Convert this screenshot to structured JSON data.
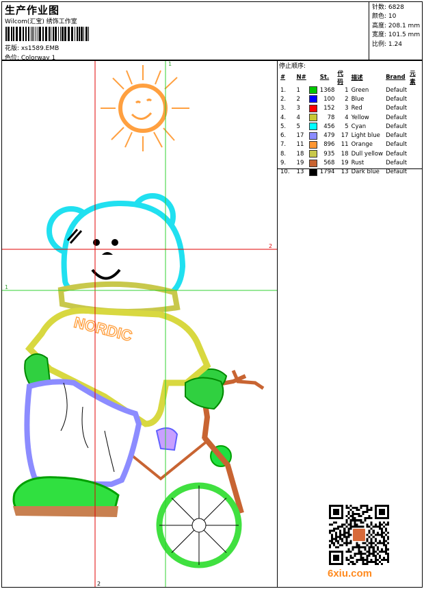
{
  "header": {
    "title": "生产作业图",
    "company": "Wilcom(汇宝) 绣饰工作室",
    "design_name": "花版:  xs1589.EMB",
    "colorway": "色位:  Colorway 1"
  },
  "stats": [
    {
      "label": "针数:",
      "value": "6828"
    },
    {
      "label": "颜色:",
      "value": "10"
    },
    {
      "label": "高度:",
      "value": "208.1 mm"
    },
    {
      "label": "宽度:",
      "value": "101.5 mm"
    },
    {
      "label": "比例:",
      "value": "1.24"
    }
  ],
  "sequence": {
    "title": "停止顺序:",
    "columns": [
      "#",
      "N#",
      "St.",
      "代码",
      "描述",
      "Brand",
      "元素"
    ],
    "rows": [
      {
        "idx": "1.",
        "n": "1",
        "st": "1368",
        "code": "1",
        "desc": "Green",
        "brand": "Default",
        "color": "#00c800"
      },
      {
        "idx": "2.",
        "n": "2",
        "st": "100",
        "code": "2",
        "desc": "Blue",
        "brand": "Default",
        "color": "#0000ff"
      },
      {
        "idx": "3.",
        "n": "3",
        "st": "152",
        "code": "3",
        "desc": "Red",
        "brand": "Default",
        "color": "#ff0000"
      },
      {
        "idx": "4.",
        "n": "4",
        "st": "78",
        "code": "4",
        "desc": "Yellow",
        "brand": "Default",
        "color": "#c8c832"
      },
      {
        "idx": "5.",
        "n": "5",
        "st": "456",
        "code": "5",
        "desc": "Cyan",
        "brand": "Default",
        "color": "#00ffff"
      },
      {
        "idx": "6.",
        "n": "17",
        "st": "479",
        "code": "17",
        "desc": "Light blue",
        "brand": "Default",
        "color": "#8c8cff"
      },
      {
        "idx": "7.",
        "n": "11",
        "st": "896",
        "code": "11",
        "desc": "Orange",
        "brand": "Default",
        "color": "#ff9632"
      },
      {
        "idx": "8.",
        "n": "18",
        "st": "935",
        "code": "18",
        "desc": "Dull yellow",
        "brand": "Default",
        "color": "#c8c84b"
      },
      {
        "idx": "9.",
        "n": "19",
        "st": "568",
        "code": "19",
        "desc": "Rust",
        "brand": "Default",
        "color": "#c86432"
      },
      {
        "idx": "10.",
        "n": "13",
        "st": "1794",
        "code": "13",
        "desc": "Dark blue",
        "brand": "Default",
        "color": "#000000"
      }
    ]
  },
  "canvas": {
    "guide_labels": {
      "green_v": "1",
      "red_h": "2",
      "green_h": "1",
      "red_v": "2"
    },
    "embroidery_text": "NORDIC"
  },
  "watermark": "6xiu.com"
}
